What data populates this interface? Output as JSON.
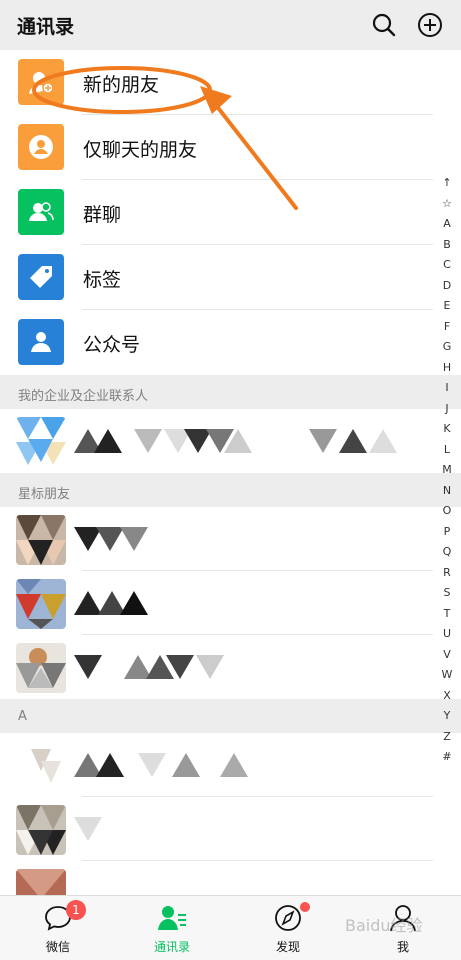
{
  "header": {
    "title": "通讯录",
    "search_icon": "search-icon",
    "add_icon": "plus-circle-icon"
  },
  "functions": [
    {
      "label": "新的朋友",
      "icon": "new-friend-icon",
      "color": "#fa9d3b"
    },
    {
      "label": "仅聊天的朋友",
      "icon": "chat-only-icon",
      "color": "#fa9d3b"
    },
    {
      "label": "群聊",
      "icon": "group-icon",
      "color": "#07c160"
    },
    {
      "label": "标签",
      "icon": "tag-icon",
      "color": "#2782d7"
    },
    {
      "label": "公众号",
      "icon": "official-account-icon",
      "color": "#2782d7"
    }
  ],
  "sections": {
    "enterprise": "我的企业及企业联系人",
    "starred": "星标朋友",
    "a": "A"
  },
  "index_letters": [
    "↑",
    "☆",
    "A",
    "B",
    "C",
    "D",
    "E",
    "F",
    "G",
    "H",
    "I",
    "J",
    "K",
    "L",
    "M",
    "N",
    "O",
    "P",
    "Q",
    "R",
    "S",
    "T",
    "U",
    "V",
    "W",
    "X",
    "Y",
    "Z",
    "#"
  ],
  "tabs": [
    {
      "label": "微信",
      "icon": "chat-bubble-icon",
      "badge": "1"
    },
    {
      "label": "通讯录",
      "icon": "contacts-icon"
    },
    {
      "label": "发现",
      "icon": "compass-icon"
    },
    {
      "label": "我",
      "icon": "person-icon"
    }
  ],
  "watermark": "Baidu经验",
  "colors": {
    "accent": "#07c160",
    "annotation": "#f07a1e"
  }
}
